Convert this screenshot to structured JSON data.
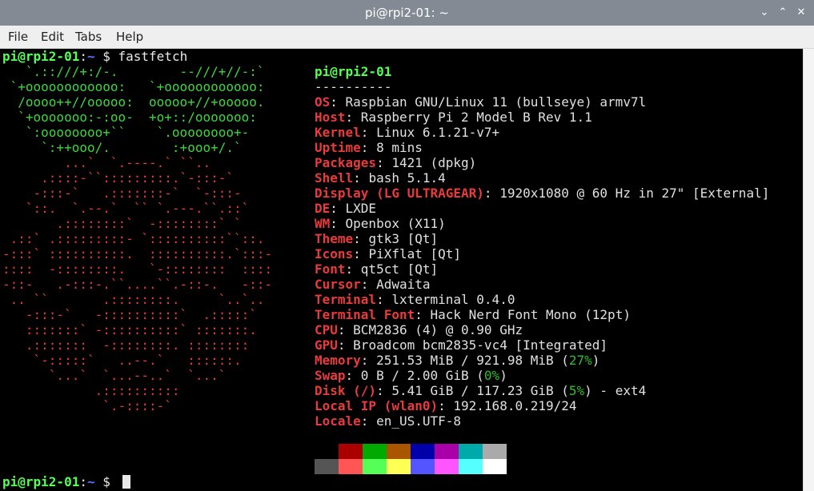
{
  "window": {
    "title": "pi@rpi2-01: ~",
    "minimize_glyph": "⌄",
    "maximize_glyph": "⌃",
    "close_glyph": "✕"
  },
  "menu": {
    "items": [
      "File",
      "Edit",
      "Tabs",
      "Help"
    ]
  },
  "prompt": {
    "user": "pi@rpi2-01",
    "colon": ":",
    "path": "~",
    "symbol": " $ ",
    "command": "fastfetch"
  },
  "logo": {
    "green": [
      "   `.::///+:/-.        --///+//-:`",
      " `+oooooooooooo:   `+oooooooooooo:",
      "  /oooo++//ooooo:  ooooo+//+ooooo.",
      "  `+ooooooo:-:oo-  +o+::/ooooooo:",
      "   `:oooooooo+``    `.oooooooo+-",
      "     `:++ooo/.        :+ooo+/.`"
    ],
    "red": [
      "        ...`  `.----.` ``..",
      "     .::::-``:::::::::.`-:::-`",
      "    -:::-`   .:::::::-`  `-:::-",
      "   `::.  `.--.`  `` `.---.``.::`",
      "       .::::::::`  -::::::::` `",
      " .::` .:::::::::- `::::::::::``::.",
      "-:::` ::::::::::.  ::::::::::.`:::-",
      "::::  -::::::::.   `-::::::::  ::::",
      "-::-   .-:::-.``....``.-::-.   -::-",
      " .. ``       .::::::::.     `..`..",
      "   -:::-`   -::::::::::`  .:::::`",
      "   :::::::` -::::::::::` :::::::.",
      "   .:::::::  -::::::::. ::::::::",
      "    `-:::::`   ..--.`   ::::::.",
      "      `...`  `...--..`  `...`",
      "            .::::::::::",
      "             `.-::::-`"
    ]
  },
  "info": {
    "host_header": "pi@rpi2-01",
    "separator": "----------",
    "rows": [
      {
        "key": "OS",
        "value": ": Raspbian GNU/Linux 11 (bullseye) armv7l"
      },
      {
        "key": "Host",
        "value": ": Raspberry Pi 2 Model B Rev 1.1"
      },
      {
        "key": "Kernel",
        "value": ": Linux 6.1.21-v7+"
      },
      {
        "key": "Uptime",
        "value": ": 8 mins"
      },
      {
        "key": "Packages",
        "value": ": 1421 (dpkg)"
      },
      {
        "key": "Shell",
        "value": ": bash 5.1.4"
      },
      {
        "key": "Display (LG ULTRAGEAR)",
        "value": ": 1920x1080 @ 60 Hz in 27\" [External]"
      },
      {
        "key": "DE",
        "value": ": LXDE"
      },
      {
        "key": "WM",
        "value": ": Openbox (X11)"
      },
      {
        "key": "Theme",
        "value": ": gtk3 [Qt]"
      },
      {
        "key": "Icons",
        "value": ": PiXflat [Qt]"
      },
      {
        "key": "Font",
        "value": ": qt5ct [Qt]"
      },
      {
        "key": "Cursor",
        "value": ": Adwaita"
      },
      {
        "key": "Terminal",
        "value": ": lxterminal 0.4.0"
      },
      {
        "key": "Terminal Font",
        "value": ": Hack Nerd Font Mono (12pt)"
      },
      {
        "key": "CPU",
        "value": ": BCM2836 (4) @ 0.90 GHz"
      },
      {
        "key": "GPU",
        "value": ": Broadcom bcm2835-vc4 [Integrated]"
      },
      {
        "key": "Memory",
        "value": ": 251.53 MiB / 921.98 MiB (",
        "pct": "27%",
        "tail": ")"
      },
      {
        "key": "Swap",
        "value": ": 0 B / 2.00 GiB (",
        "pct": "0%",
        "tail": ")"
      },
      {
        "key": "Disk (/)",
        "value": ": 5.41 GiB / 117.23 GiB (",
        "pct": "5%",
        "tail": ") - ext4"
      },
      {
        "key": "Local IP (wlan0)",
        "value": ": 192.168.0.219/24"
      },
      {
        "key": "Locale",
        "value": ": en_US.UTF-8"
      }
    ]
  },
  "palette": {
    "normal": [
      "#000000",
      "#aa0000",
      "#00aa00",
      "#aa5500",
      "#0000aa",
      "#aa00aa",
      "#00aaaa",
      "#aaaaaa"
    ],
    "bright": [
      "#555555",
      "#ff5555",
      "#55ff55",
      "#ffff55",
      "#5555ff",
      "#ff55ff",
      "#55ffff",
      "#ffffff"
    ]
  }
}
